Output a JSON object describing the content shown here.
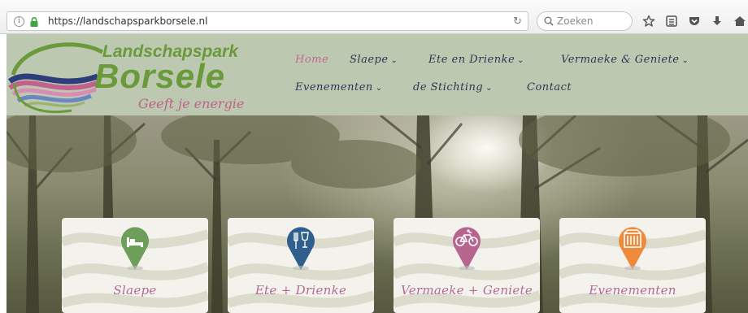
{
  "browser": {
    "url": "https://landschapsparkborsele.nl",
    "search_placeholder": "Zoeken",
    "icons": [
      "info-icon",
      "lock-icon",
      "reload-icon",
      "search-icon",
      "star-icon",
      "reading-list-icon",
      "pocket-icon",
      "download-icon",
      "home-icon"
    ]
  },
  "logo": {
    "line1": "Landschapspark",
    "line2": "Borsele",
    "tagline": "Geeft je energie"
  },
  "nav": {
    "items": [
      {
        "label": "Home",
        "has_dropdown": false,
        "active": true
      },
      {
        "label": "Slaepe",
        "has_dropdown": true
      },
      {
        "label": "Ete en Drienke",
        "has_dropdown": true
      },
      {
        "label": "Vermaeke & Geniete",
        "has_dropdown": true
      },
      {
        "label": "Evenementen",
        "has_dropdown": true
      },
      {
        "label": "de Stichting",
        "has_dropdown": true
      },
      {
        "label": "Contact",
        "has_dropdown": false
      }
    ],
    "chevron": "⌄"
  },
  "cards": [
    {
      "label": "Slaepe",
      "icon": "bed-icon",
      "pin_color": "#6d9e5a"
    },
    {
      "label": "Ete + Drienke",
      "icon": "cutlery-glass-icon",
      "pin_color": "#2f5f8c"
    },
    {
      "label": "Vermaeke + Geniete",
      "icon": "bicycle-icon",
      "pin_color": "#b7658f"
    },
    {
      "label": "Evenementen",
      "icon": "event-tent-icon",
      "pin_color": "#ee8a3a"
    }
  ],
  "colors": {
    "header_bg": "#bcc8b0",
    "logo_green": "#6b9a3c",
    "tagline_pink": "#c0618e",
    "nav_text": "#2d3556",
    "nav_active": "#c06a93"
  }
}
